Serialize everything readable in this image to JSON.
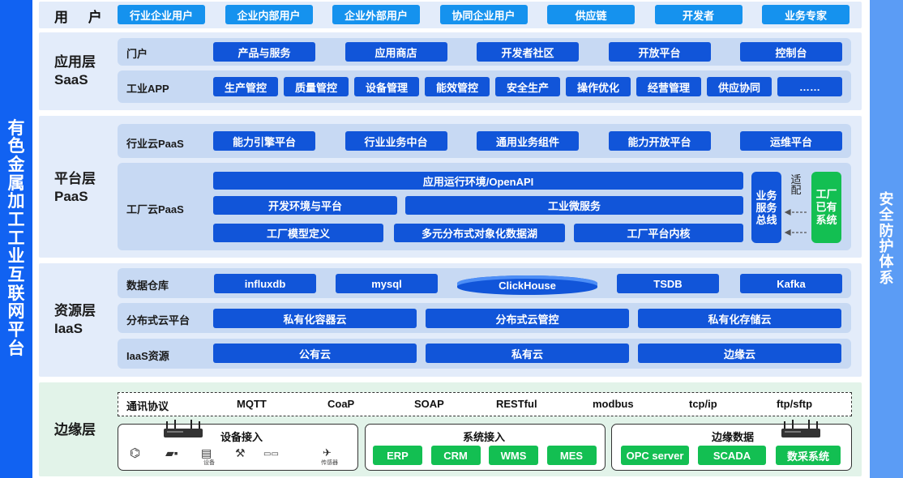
{
  "left_title": "有色金属加工工业互联网平台",
  "right_title": "安全防护体系",
  "users": {
    "label": "用 户",
    "items": [
      "行业企业用户",
      "企业内部用户",
      "企业外部用户",
      "协同企业用户",
      "供应链",
      "开发者",
      "业务专家"
    ]
  },
  "saas": {
    "name_cn": "应用层",
    "name_en": "SaaS",
    "portal_label": "门户",
    "portal_items": [
      "产品与服务",
      "应用商店",
      "开发者社区",
      "开放平台",
      "控制台"
    ],
    "app_label": "工业APP",
    "app_items": [
      "生产管控",
      "质量管控",
      "设备管理",
      "能效管控",
      "安全生产",
      "操作优化",
      "经营管理",
      "供应协同",
      "……"
    ]
  },
  "paas": {
    "name_cn": "平台层",
    "name_en": "PaaS",
    "industry_label": "行业云PaaS",
    "industry_items": [
      "能力引擎平台",
      "行业业务中台",
      "通用业务组件",
      "能力开放平台",
      "运维平台"
    ],
    "factory_label": "工厂云PaaS",
    "runtime": "应用运行环境/OpenAPI",
    "dev_env": "开发环境与平台",
    "micro": "工业微服务",
    "model": "工厂模型定义",
    "datalake": "多元分布式对象化数据湖",
    "kernel": "工厂平台内核",
    "bus": "业务服务总线",
    "adapt": "适配",
    "existing": "工厂已有系统"
  },
  "iaas": {
    "name_cn": "资源层",
    "name_en": "IaaS",
    "dw_label": "数据仓库",
    "dw_items": [
      "influxdb",
      "mysql",
      "ClickHouse",
      "TSDB",
      "Kafka"
    ],
    "dist_label": "分布式云平台",
    "dist_items": [
      "私有化容器云",
      "分布式云管控",
      "私有化存储云"
    ],
    "res_label": "IaaS资源",
    "res_items": [
      "公有云",
      "私有云",
      "边缘云"
    ]
  },
  "edge": {
    "name_cn": "边缘层",
    "protocol_label": "通讯协议",
    "protocols": [
      "MQTT",
      "CoaP",
      "SOAP",
      "RESTful",
      "modbus",
      "tcp/ip",
      "ftp/sftp"
    ],
    "device_title": "设备接入",
    "device_small_1": "设备",
    "device_small_2": "传感器",
    "system_title": "系统接入",
    "system_items": [
      "ERP",
      "CRM",
      "WMS",
      "MES"
    ],
    "edgedata_title": "边缘数据",
    "edgedata_items": [
      "OPC server",
      "SCADA",
      "数采系统"
    ]
  },
  "colors": {
    "left_bar": "#1162f2",
    "right_bar": "#5b9cf5",
    "band": "#e3ecfa",
    "edge_band": "#e2f3e9",
    "row": "#c7d9f3",
    "button": "#1155d9",
    "user_button": "#1592ee",
    "green": "#13bf52"
  }
}
